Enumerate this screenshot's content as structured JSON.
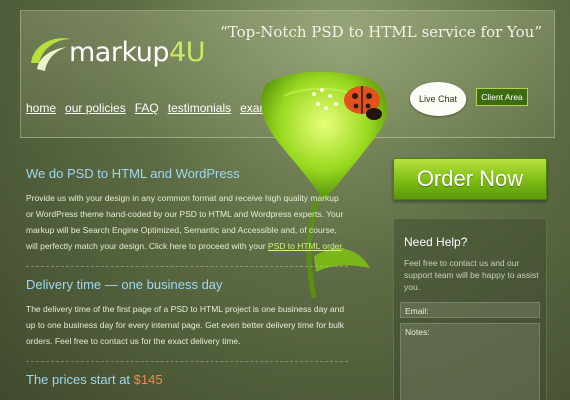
{
  "brand": {
    "name_prefix": "markup",
    "name_suffix": "4U",
    "tagline": "“Top-Notch PSD to HTML service for You”",
    "colors": {
      "accent_green": "#cbe861",
      "heading_blue": "#9fd8ee",
      "price_orange": "#f08a4b",
      "order_button": "#7dbb14"
    }
  },
  "nav": {
    "items": [
      {
        "label": "home"
      },
      {
        "label": "our policies"
      },
      {
        "label": "FAQ"
      },
      {
        "label": "testimonials"
      },
      {
        "label": "examples"
      }
    ]
  },
  "header_buttons": {
    "live_chat": "Live Chat",
    "client_area": "Client Area"
  },
  "main": {
    "section1": {
      "heading": "We do PSD to HTML and WordPress",
      "text": "Provide us with your design in any common format and receive high quality markup or WordPress theme hand-coded by our PSD to HTML and Wordpress experts. Your markup will be Search Engine Optimized, Semantic and Accessible and, of course, will perfectly match your design. Click here to proceed with your",
      "link": "PSD to HTML order",
      "text_end": "."
    },
    "section2": {
      "heading": "Delivery time — one business day",
      "text": "The delivery time of the first page of a PSD to HTML project is one business day and up to one business day for every internal page. Get even better delivery time for bulk orders. Feel free to contact us for the exact delivery time."
    },
    "section3": {
      "heading": "The prices start at",
      "price": "$145"
    }
  },
  "sidebar": {
    "order_button": "Order Now",
    "help_title": "Need Help?",
    "help_text": "Feel free to contact us and our support team will be happy to assist you.",
    "email_label": "Email:",
    "notes_label": "Notes:"
  },
  "icons": {
    "logo": "leaf-swoosh-icon",
    "flower": "green-flower-illustration",
    "ladybug": "ladybug-icon",
    "chat": "speech-bubble-icon"
  }
}
